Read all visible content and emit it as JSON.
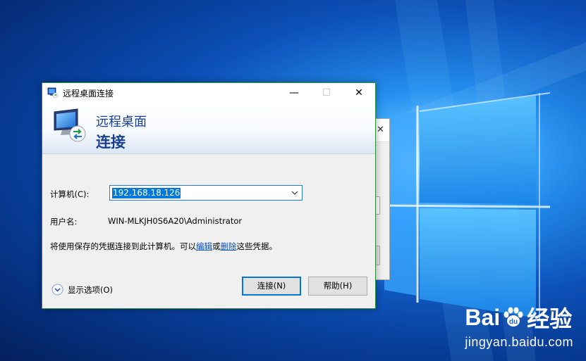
{
  "dialog": {
    "title": "远程桌面连接",
    "header_line1": "远程桌面",
    "header_line2": "连接",
    "computer_label": "计算机(C):",
    "computer_value": "192.168.18.126",
    "username_label": "用户名:",
    "username_value": "WIN-MLKJH0S6A20\\Administrator",
    "info_prefix": "将使用保存的凭据连接到此计算机。可以",
    "info_link_edit": "编辑",
    "info_or": "或",
    "info_link_delete": "删除",
    "info_suffix": "这些凭据。",
    "show_options": "显示选项(O)",
    "connect_button": "连接(N)",
    "help_button": "帮助(H)"
  },
  "watermark": {
    "brand_left": "Bai",
    "brand_right": "经验",
    "url": "jingyan.baidu.com"
  },
  "colors": {
    "accent": "#0078d7",
    "header_text": "#1a3f8f",
    "link": "#0050c8",
    "frame": "#2f8f3f"
  },
  "icons": {
    "title_icon": "remote-desktop-icon",
    "header_icon": "monitor-remote-icon",
    "options_icon": "chevron-down-circle-icon",
    "combo_arrow": "chevron-down-icon"
  }
}
